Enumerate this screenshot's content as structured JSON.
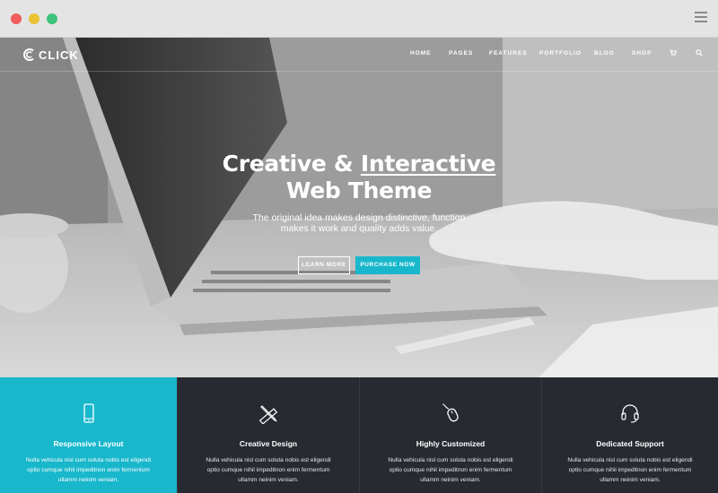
{
  "browser": {
    "dots": [
      {
        "name": "close",
        "color": "#f05b5b"
      },
      {
        "name": "minimize",
        "color": "#e9c332"
      },
      {
        "name": "maximize",
        "color": "#3ec47a"
      }
    ],
    "menu_icon": "hamburger-icon"
  },
  "site": {
    "logo_text": "CLICK",
    "logo_icon": "c-logo-icon",
    "nav": [
      "HOME",
      "PAGES",
      "FEATURES",
      "PORTFOLIO",
      "BLOG",
      "SHOP"
    ],
    "cart_icon": "cart-icon",
    "search_icon": "search-icon"
  },
  "hero": {
    "headline_prefix": "Creative & ",
    "headline_highlight": "Interactive",
    "headline_line2": "Web Theme",
    "tagline_line1": "The original idea makes design distinctive, function",
    "tagline_line2": "makes it work and quality adds value.",
    "learn_more": "LEARN MORE",
    "purchase_now": "PURCHASE NOW",
    "accent_color": "#19b7cc"
  },
  "features": [
    {
      "icon": "mobile-phone-icon",
      "title": "Responsive Layout",
      "line1": "Nulla vehicula nisl cum soluta nobis est eligendi",
      "line2": "optio cumque nihil impeditnon enim fermentum",
      "line3": "ullamm neinim veniam.",
      "active": true
    },
    {
      "icon": "pencil-ruler-icon",
      "title": "Creative Design",
      "line1": "Nulla vehicula nisl cum soluta nobis est eligendi",
      "line2": "optio cumque nihil impeditnon enim fermentum",
      "line3": "ullamm neinim veniam.",
      "active": false
    },
    {
      "icon": "mouse-icon",
      "title": "Highly Customized",
      "line1": "Nulla vehicula nisl cum soluta nobis est eligendi",
      "line2": "optio cumque nihil impeditnon enim fermentum",
      "line3": "ullamm neinim veniam.",
      "active": false
    },
    {
      "icon": "headset-icon",
      "title": "Dedicated Support",
      "line1": "Nulla vehicula nisl cum soluta nobis est eligendi",
      "line2": "optio cumque nihil impeditnon enim fermentum",
      "line3": "ullamm neinim veniam.",
      "active": false
    }
  ]
}
